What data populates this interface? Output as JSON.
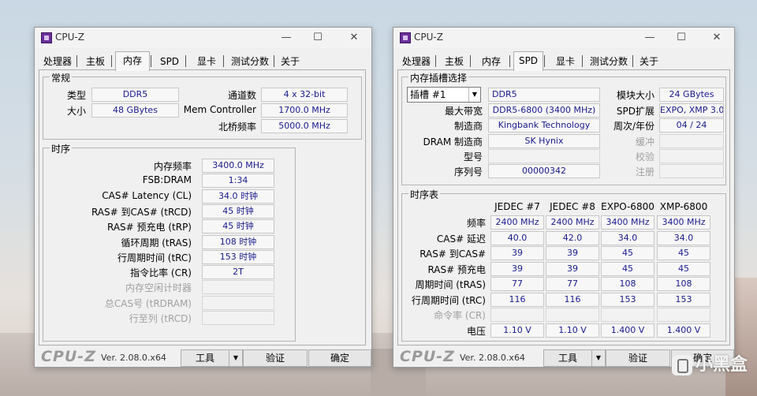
{
  "common": {
    "window_title": "CPU-Z",
    "logo": "CPU-Z",
    "version": "Ver. 2.08.0.x64",
    "tools_label": "工具",
    "validate_label": "验证",
    "ok_label": "确定",
    "minimize": "—",
    "maximize": "☐",
    "close": "✕",
    "tabs": [
      "处理器",
      "主板",
      "内存",
      "SPD",
      "显卡",
      "测试分数",
      "关于"
    ]
  },
  "memory_window": {
    "active_tab": "内存",
    "general": {
      "title": "常规",
      "type_label": "类型",
      "type_value": "DDR5",
      "size_label": "大小",
      "size_value": "48 GBytes",
      "channels_label": "通道数",
      "channels_value": "4 x 32-bit",
      "mem_controller_label": "Mem Controller",
      "mem_controller_value": "1700.0 MHz",
      "northbridge_label": "北桥频率",
      "northbridge_value": "5000.0 MHz"
    },
    "timings": {
      "title": "时序",
      "rows": [
        {
          "label": "内存频率",
          "value": "3400.0 MHz",
          "disabled": false
        },
        {
          "label": "FSB:DRAM",
          "value": "1:34",
          "disabled": false
        },
        {
          "label": "CAS# Latency (CL)",
          "value": "34.0 时钟",
          "disabled": false
        },
        {
          "label": "RAS# 到CAS# (tRCD)",
          "value": "45 时钟",
          "disabled": false
        },
        {
          "label": "RAS# 预充电 (tRP)",
          "value": "45 时钟",
          "disabled": false
        },
        {
          "label": "循环周期 (tRAS)",
          "value": "108 时钟",
          "disabled": false
        },
        {
          "label": "行周期时间 (tRC)",
          "value": "153 时钟",
          "disabled": false
        },
        {
          "label": "指令比率 (CR)",
          "value": "2T",
          "disabled": false
        },
        {
          "label": "内存空闲计时器",
          "value": "",
          "disabled": true
        },
        {
          "label": "总CAS号 (tRDRAM)",
          "value": "",
          "disabled": true
        },
        {
          "label": "行至列 (tRCD)",
          "value": "",
          "disabled": true
        }
      ]
    }
  },
  "spd_window": {
    "active_tab": "SPD",
    "slot": {
      "title": "内存插槽选择",
      "slot_select": "插槽 #1",
      "type_value": "DDR5",
      "max_bandwidth_label": "最大带宽",
      "max_bandwidth_value": "DDR5-6800 (3400 MHz)",
      "manufacturer_label": "制造商",
      "manufacturer_value": "Kingbank Technology",
      "dram_mfr_label": "DRAM 制造商",
      "dram_mfr_value": "SK Hynix",
      "part_label": "型号",
      "part_value": "",
      "serial_label": "序列号",
      "serial_value": "00000342",
      "module_size_label": "模块大小",
      "module_size_value": "24 GBytes",
      "spd_ext_label": "SPD扩展",
      "spd_ext_value": "EXPO, XMP 3.0",
      "week_year_label": "周次/年份",
      "week_year_value": "04 / 24",
      "buffered_label": "缓冲",
      "buffered_value": "",
      "corrected_label": "校验",
      "corrected_value": "",
      "registered_label": "注册",
      "registered_value": ""
    },
    "timing_table": {
      "title": "时序表",
      "columns": [
        "JEDEC #7",
        "JEDEC #8",
        "EXPO-6800",
        "XMP-6800"
      ],
      "rows": [
        {
          "label": "频率",
          "values": [
            "2400 MHz",
            "2400 MHz",
            "3400 MHz",
            "3400 MHz"
          ],
          "disabled": false
        },
        {
          "label": "CAS# 延迟",
          "values": [
            "40.0",
            "42.0",
            "34.0",
            "34.0"
          ],
          "disabled": false
        },
        {
          "label": "RAS# 到CAS#",
          "values": [
            "39",
            "39",
            "45",
            "45"
          ],
          "disabled": false
        },
        {
          "label": "RAS# 预充电",
          "values": [
            "39",
            "39",
            "45",
            "45"
          ],
          "disabled": false
        },
        {
          "label": "周期时间 (tRAS)",
          "values": [
            "77",
            "77",
            "108",
            "108"
          ],
          "disabled": false
        },
        {
          "label": "行周期时间 (tRC)",
          "values": [
            "116",
            "116",
            "153",
            "153"
          ],
          "disabled": false
        },
        {
          "label": "命令率 (CR)",
          "values": [
            "",
            "",
            "",
            ""
          ],
          "disabled": true
        },
        {
          "label": "电压",
          "values": [
            "1.10 V",
            "1.10 V",
            "1.400 V",
            "1.400 V"
          ],
          "disabled": false
        }
      ]
    }
  },
  "watermark": "小黑盒"
}
